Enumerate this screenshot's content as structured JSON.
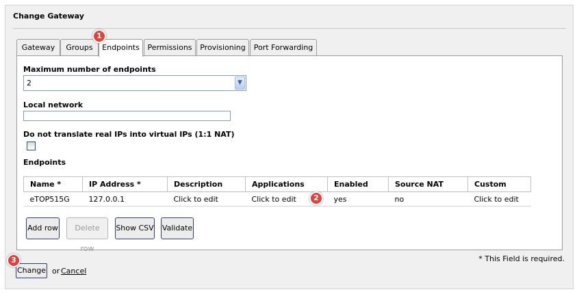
{
  "panel": {
    "title": "Change Gateway"
  },
  "tabs": [
    {
      "label": "Gateway"
    },
    {
      "label": "Groups"
    },
    {
      "label": "Endpoints",
      "active": true
    },
    {
      "label": "Permissions"
    },
    {
      "label": "Provisioning"
    },
    {
      "label": "Port Forwarding"
    }
  ],
  "form": {
    "max_endpoints": {
      "label": "Maximum number of endpoints",
      "value": "2"
    },
    "local_network": {
      "label": "Local network",
      "value": ""
    },
    "no_translate": {
      "label": "Do not translate real IPs into virtual IPs (1:1 NAT)",
      "checked": false
    },
    "endpoints_label": "Endpoints"
  },
  "table": {
    "headers": [
      "Name *",
      "IP Address *",
      "Description",
      "Applications",
      "Enabled",
      "Source NAT",
      "Custom"
    ],
    "rows": [
      [
        "eTOP515G",
        "127.0.0.1",
        "Click to edit",
        "Click to edit",
        "yes",
        "no",
        "Click to edit"
      ]
    ]
  },
  "buttons": {
    "add_row": "Add row",
    "delete_row": "Delete row",
    "show_csv": "Show CSV",
    "validate": "Validate"
  },
  "footer": {
    "required_note": "* This Field is required.",
    "change": "Change",
    "or": "or",
    "cancel": "Cancel"
  },
  "badges": [
    "1",
    "2",
    "3"
  ],
  "colors": {
    "badge": "#e2403a",
    "button_border": "#2f3b6e"
  }
}
